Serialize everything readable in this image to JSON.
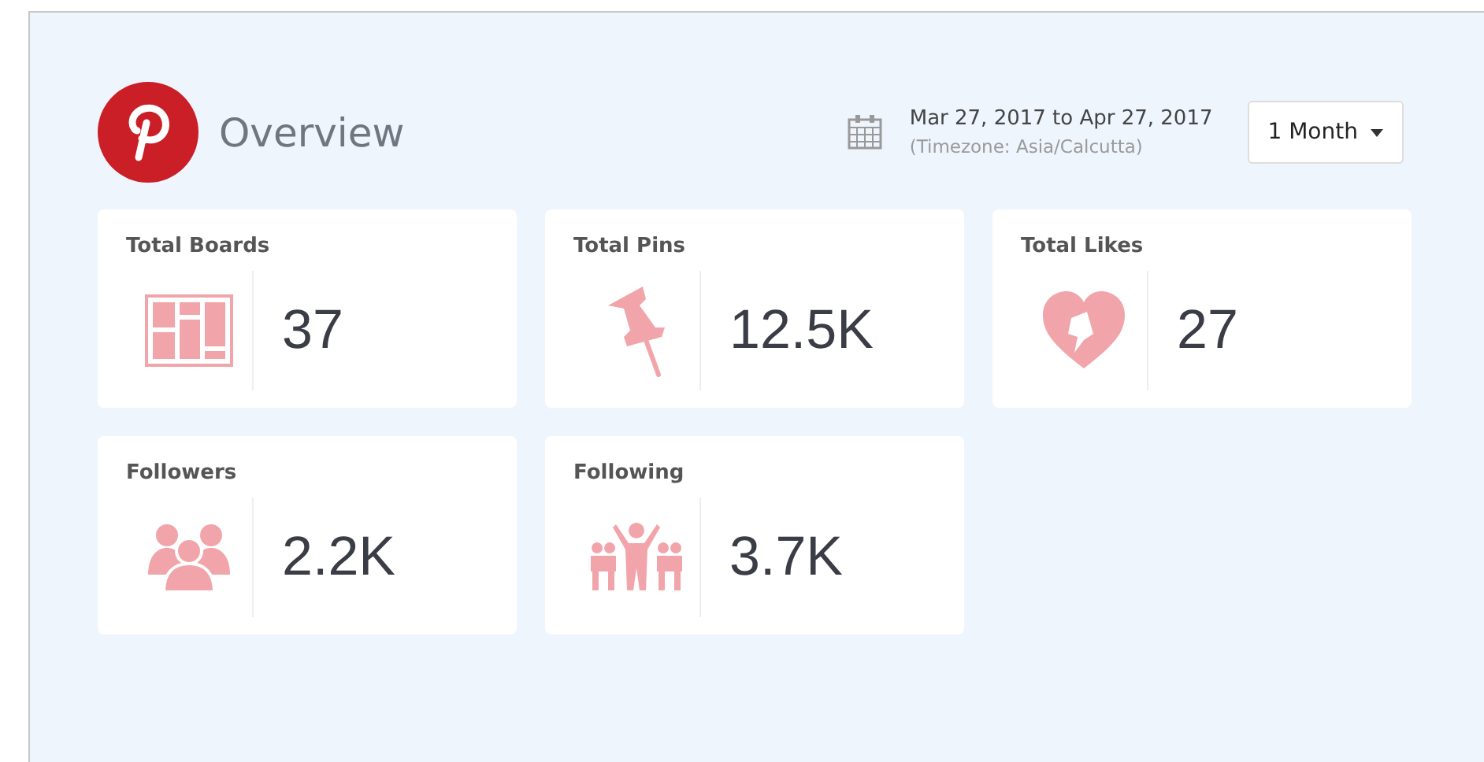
{
  "header": {
    "title": "Overview",
    "date_range": "Mar 27, 2017 to Apr 27, 2017",
    "timezone": "(Timezone: Asia/Calcutta)",
    "period_button": "1 Month"
  },
  "cards": [
    {
      "label": "Total Boards",
      "value": "37",
      "kind": "boards"
    },
    {
      "label": "Total Pins",
      "value": "12.5K",
      "kind": "pin"
    },
    {
      "label": "Total Likes",
      "value": "27",
      "kind": "heart"
    },
    {
      "label": "Followers",
      "value": "2.2K",
      "kind": "people"
    },
    {
      "label": "Following",
      "value": "3.7K",
      "kind": "crowd"
    }
  ]
}
